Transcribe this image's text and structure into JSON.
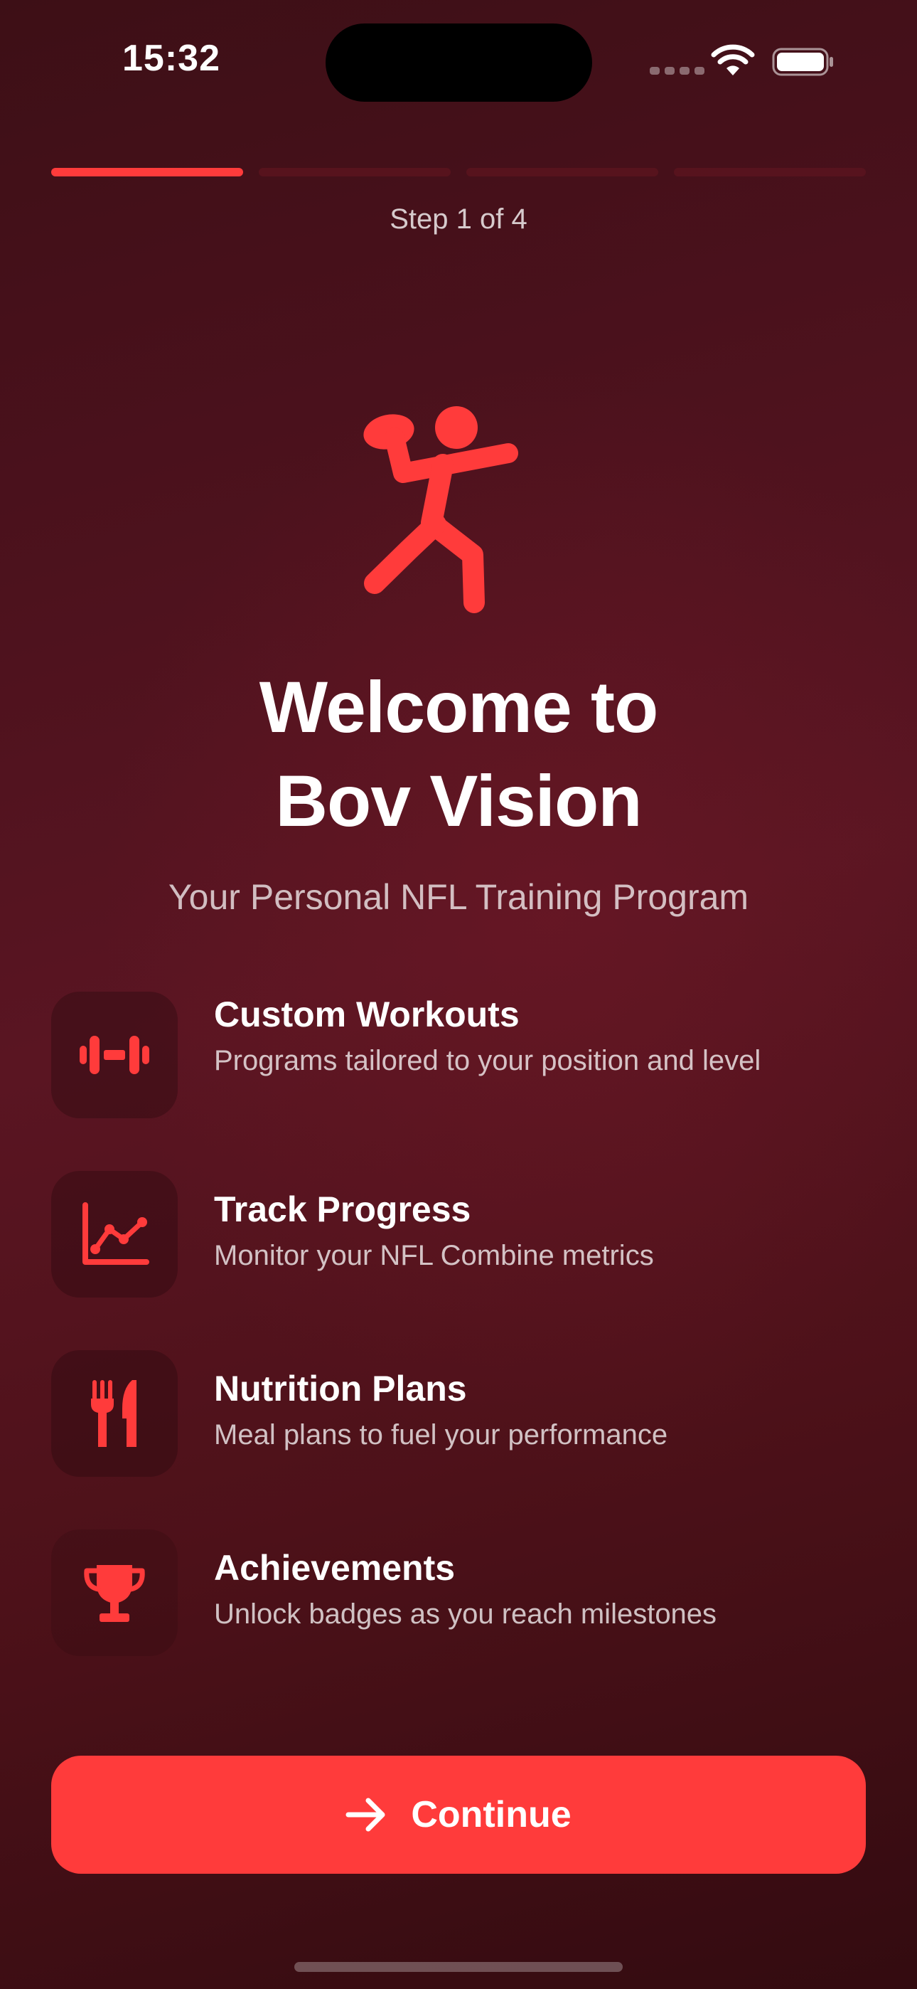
{
  "status_bar": {
    "time": "15:32",
    "icons": [
      "cellular-signal-icon",
      "wifi-icon",
      "battery-icon"
    ]
  },
  "progress": {
    "current_step": 1,
    "total_steps": 4,
    "label": "Step 1 of 4"
  },
  "hero": {
    "icon": "football-player-icon",
    "title_line1": "Welcome to",
    "title_line2": "Bov Vision",
    "subtitle": "Your Personal NFL Training Program"
  },
  "features": [
    {
      "icon": "dumbbell-icon",
      "title": "Custom Workouts",
      "description": "Programs tailored to your position and level"
    },
    {
      "icon": "chart-line-icon",
      "title": "Track Progress",
      "description": "Monitor your NFL Combine metrics"
    },
    {
      "icon": "fork-knife-icon",
      "title": "Nutrition Plans",
      "description": "Meal plans to fuel your performance"
    },
    {
      "icon": "trophy-icon",
      "title": "Achievements",
      "description": "Unlock badges as you reach milestones"
    }
  ],
  "actions": {
    "continue_icon": "arrow-right-icon",
    "continue_label": "Continue"
  },
  "colors": {
    "accent": "#ff3b3b",
    "background_dark": "#3d0f16",
    "background_mid": "#5a1522",
    "text_primary": "#ffffff"
  }
}
